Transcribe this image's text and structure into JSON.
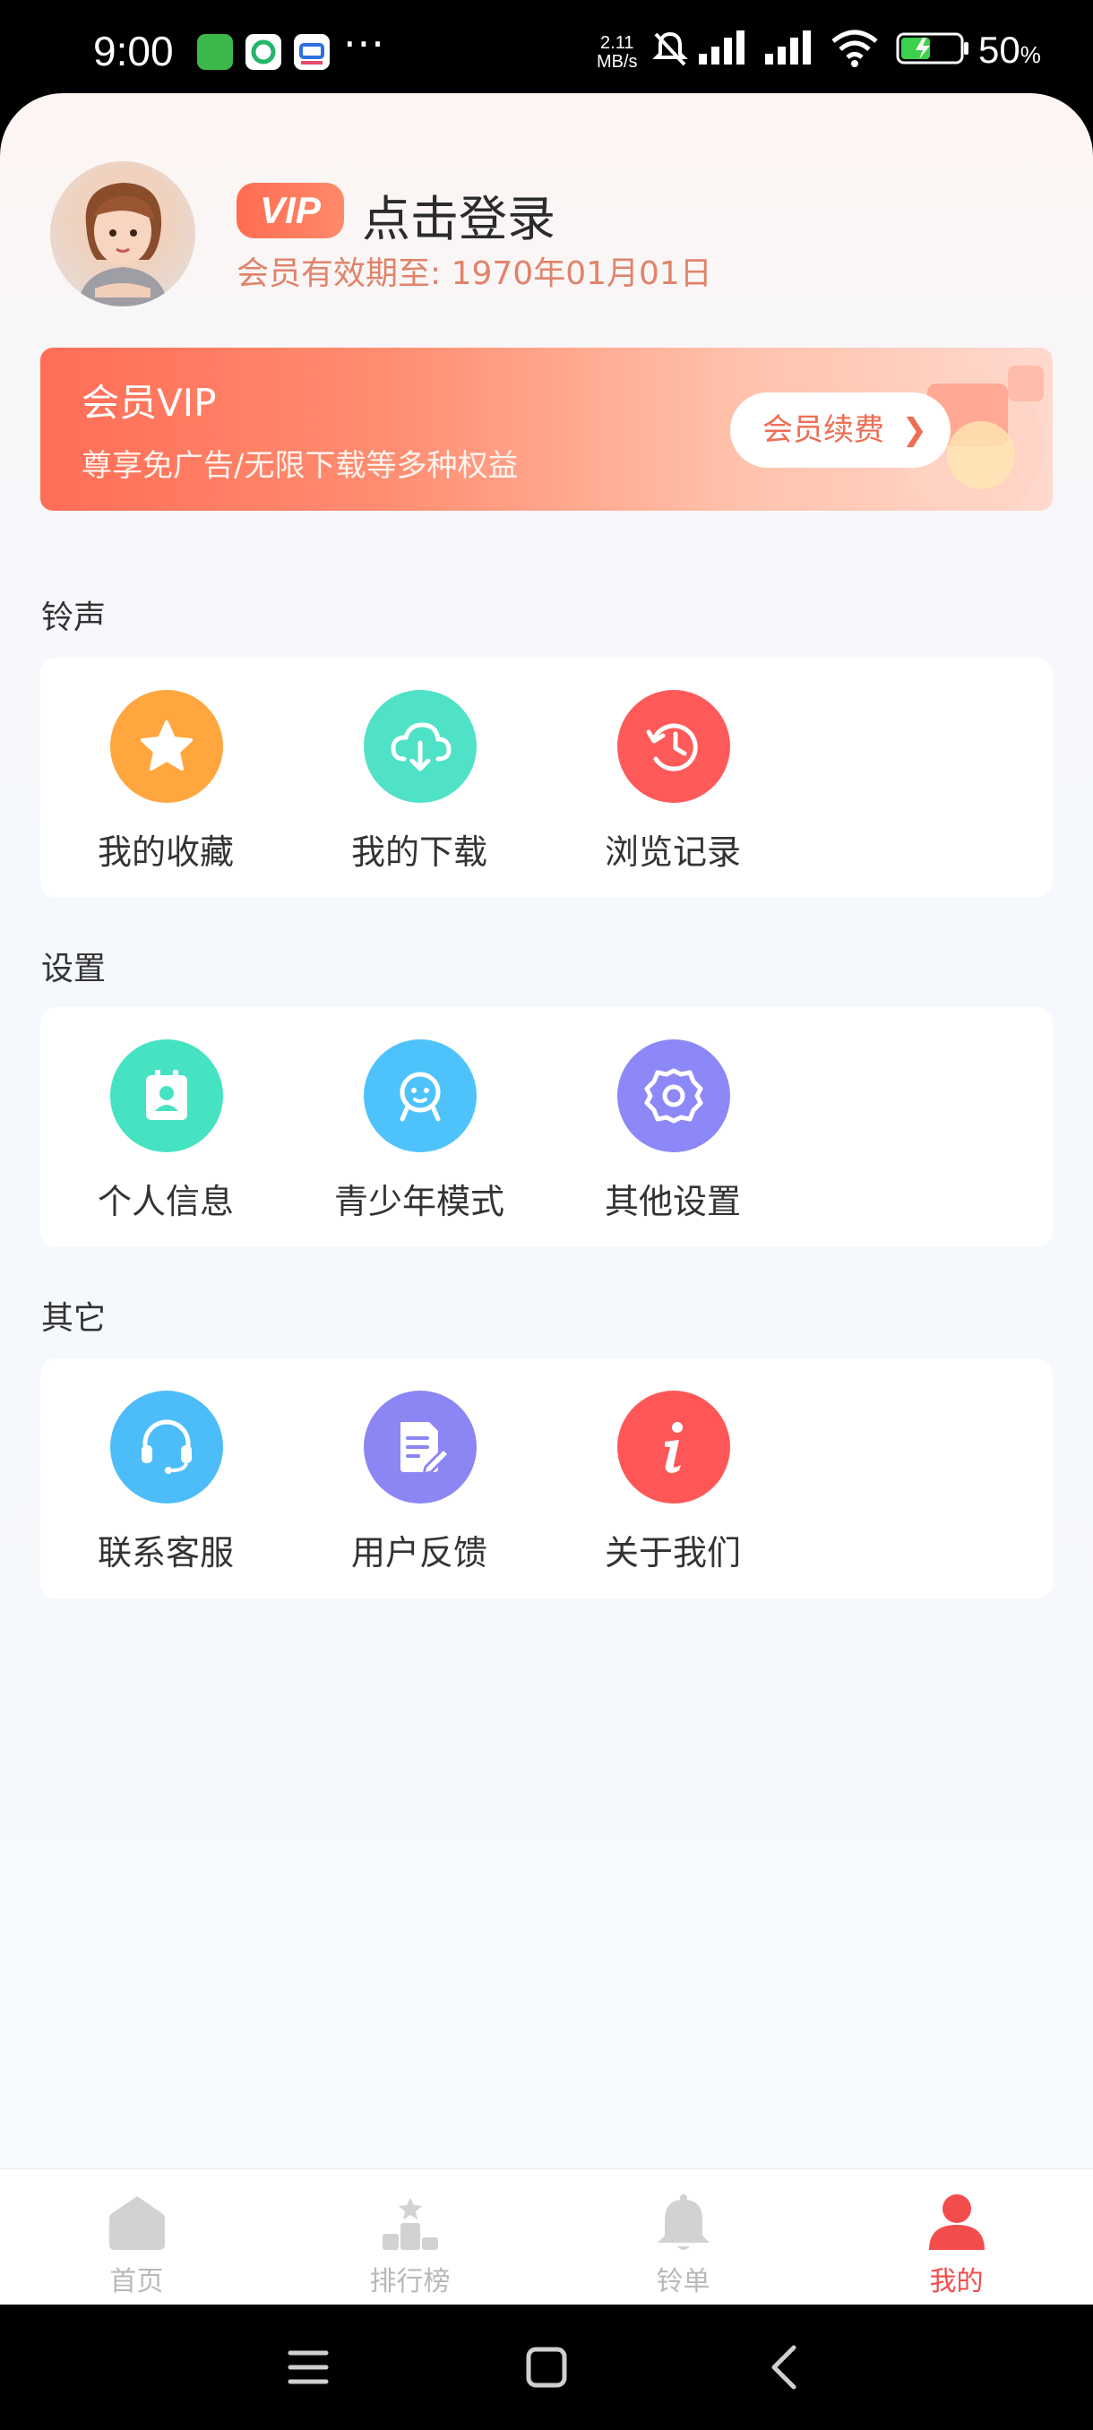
{
  "status_bar": {
    "time": "9:00",
    "net_speed_value": "2.11",
    "net_speed_unit": "MB/s",
    "battery_percent": "50",
    "battery_unit": "%",
    "battery_level": 0.5,
    "icons": [
      "app-icon-free-ringtone",
      "app-icon-green",
      "app-icon-blue",
      "more-dots-icon",
      "mute-bell-icon",
      "signal-icon",
      "signal-icon",
      "wifi-icon",
      "battery-charging-icon"
    ]
  },
  "profile": {
    "vip_badge": "VIP",
    "login_label": "点击登录",
    "expire_text": "会员有效期至: 1970年01月01日"
  },
  "vip_card": {
    "title": "会员VIP",
    "subtitle": "尊享免广告/无限下载等多种权益",
    "renew_label": "会员续费",
    "renew_chevron": "❯"
  },
  "sections": [
    {
      "title": "铃声",
      "items": [
        {
          "label": "我的收藏",
          "icon": "star-icon",
          "color": "#ffa63f"
        },
        {
          "label": "我的下载",
          "icon": "cloud-download-icon",
          "color": "#4fe2c6"
        },
        {
          "label": "浏览记录",
          "icon": "history-icon",
          "color": "#ff5a5a"
        }
      ]
    },
    {
      "title": "设置",
      "items": [
        {
          "label": "个人信息",
          "icon": "profile-card-icon",
          "color": "#45e3c2"
        },
        {
          "label": "青少年模式",
          "icon": "teen-face-icon",
          "color": "#4ec3fb"
        },
        {
          "label": "其他设置",
          "icon": "gear-icon",
          "color": "#8d88f7"
        }
      ]
    },
    {
      "title": "其它",
      "items": [
        {
          "label": "联系客服",
          "icon": "headset-icon",
          "color": "#4dbdf9"
        },
        {
          "label": "用户反馈",
          "icon": "feedback-icon",
          "color": "#8b86f4"
        },
        {
          "label": "关于我们",
          "icon": "info-icon",
          "color": "#ff5757"
        }
      ]
    }
  ],
  "tabbar": {
    "tabs": [
      {
        "label": "首页",
        "icon": "home-icon",
        "active": false
      },
      {
        "label": "排行榜",
        "icon": "ranking-icon",
        "active": false
      },
      {
        "label": "铃单",
        "icon": "bell-icon",
        "active": false
      },
      {
        "label": "我的",
        "icon": "user-icon",
        "active": true
      }
    ],
    "active_color": "#f34c4c",
    "inactive_color": "#c8c8c8"
  },
  "navbar": {
    "icons": [
      "menu-icon",
      "home-square-icon",
      "back-icon"
    ]
  }
}
